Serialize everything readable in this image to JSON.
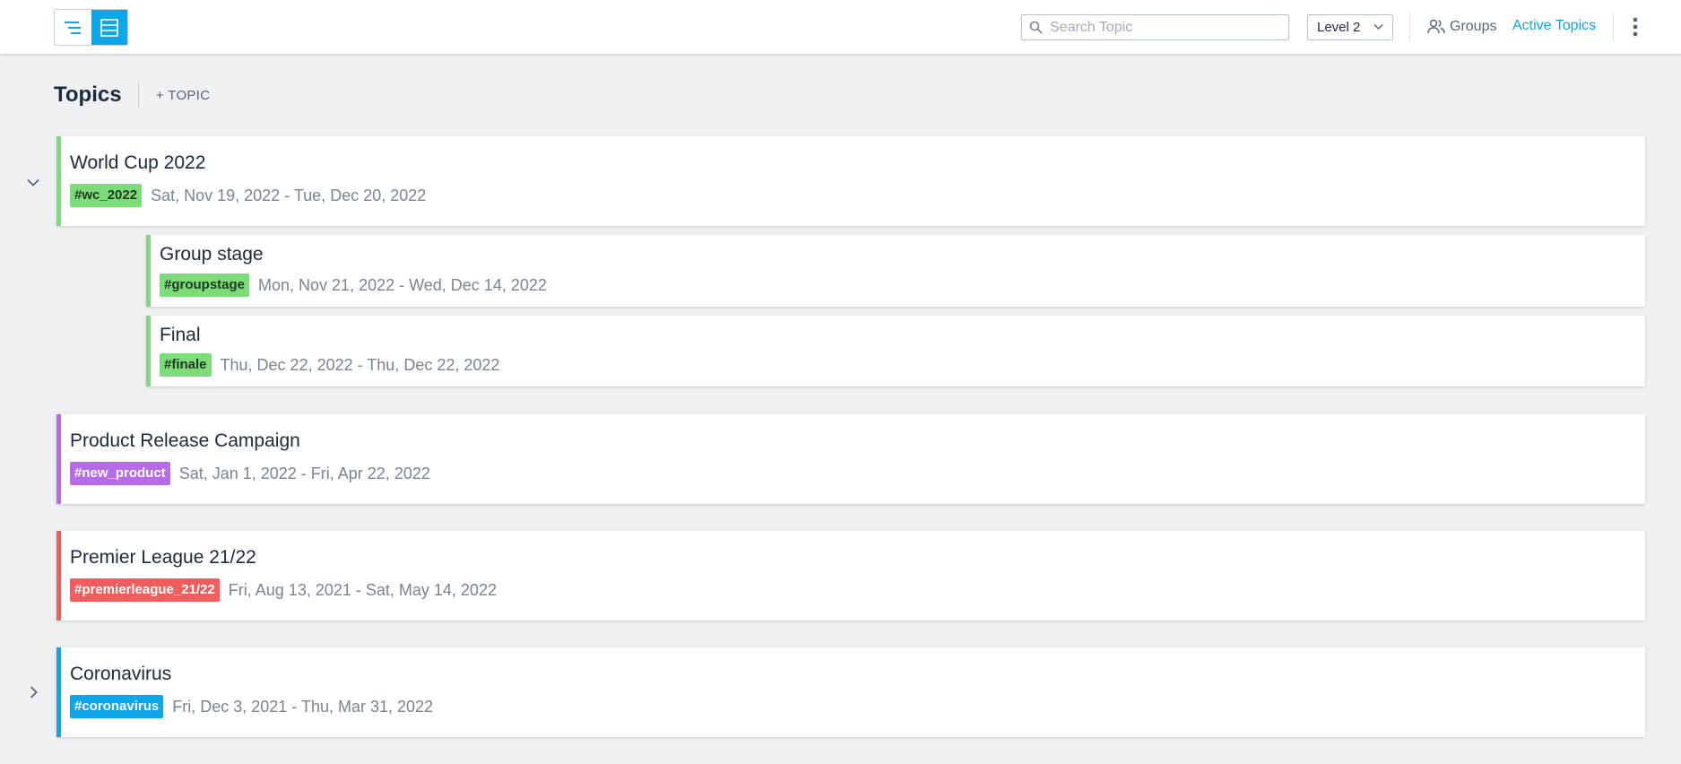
{
  "header": {
    "search": {
      "placeholder": "Search Topic",
      "value": ""
    },
    "level_select": {
      "value": "Level 2"
    },
    "groups_label": "Groups",
    "active_topics_label": "Active Topics"
  },
  "page": {
    "title": "Topics",
    "add_topic_label": "+ TOPIC"
  },
  "topics": [
    {
      "name": "World Cup 2022",
      "tag": "#wc_2022",
      "dates": "Sat, Nov 19, 2022 - Tue, Dec 20, 2022",
      "color": "#7ddc7a",
      "expanded": true,
      "children": [
        {
          "name": "Group stage",
          "tag": "#groupstage",
          "dates": "Mon, Nov 21, 2022 - Wed, Dec 14, 2022",
          "color": "#7ddc7a"
        },
        {
          "name": "Final",
          "tag": "#finale",
          "dates": "Thu, Dec 22, 2022 - Thu, Dec 22, 2022",
          "color": "#7ddc7a"
        }
      ]
    },
    {
      "name": "Product Release Campaign",
      "tag": "#new_product",
      "dates": "Sat, Jan 1, 2022 - Fri, Apr 22, 2022",
      "color": "#b56ce6"
    },
    {
      "name": "Premier League 21/22",
      "tag": "#premierleague_21/22",
      "dates": "Fri, Aug 13, 2021 - Sat, May 14, 2022",
      "color": "#f05d5d"
    },
    {
      "name": "Coronavirus",
      "tag": "#coronavirus",
      "dates": "Fri, Dec 3, 2021 - Thu, Mar 31, 2022",
      "color": "#0ea5e9",
      "expanded": false
    }
  ],
  "colors": {
    "accent": "#0ea5e9",
    "green": "#7ddc7a",
    "purple": "#b56ce6",
    "red": "#f05d5d",
    "blue": "#0ea5e9"
  }
}
